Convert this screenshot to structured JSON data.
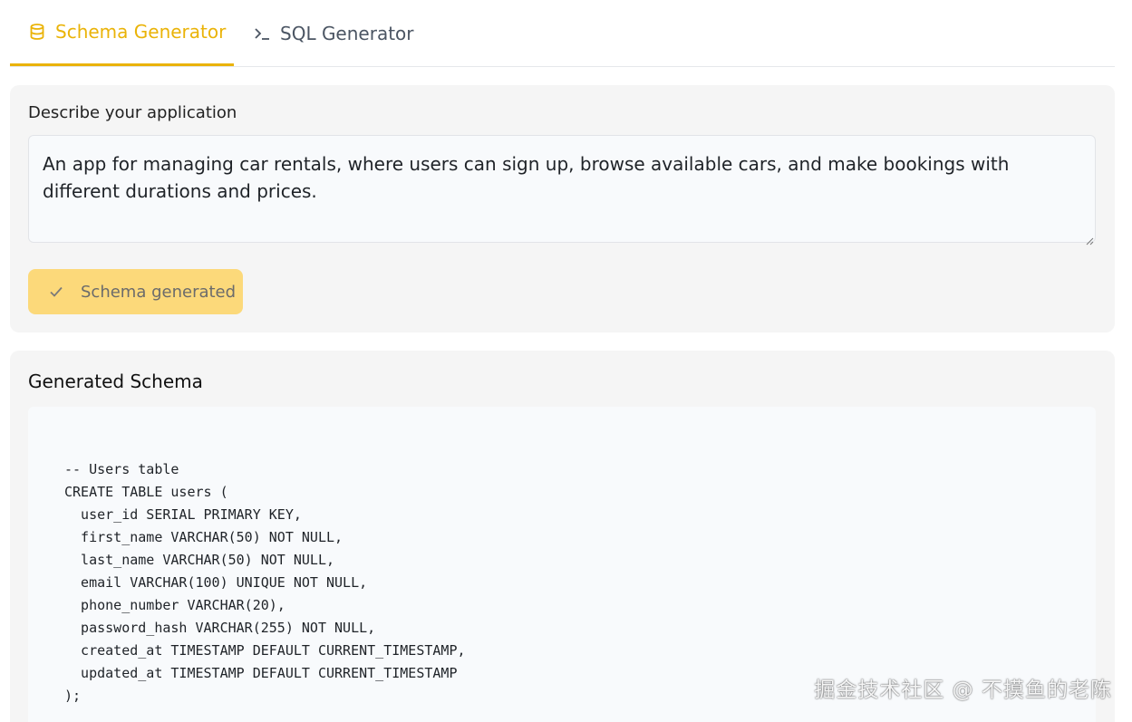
{
  "tabs": {
    "schema_label": "Schema Generator",
    "sql_label": "SQL Generator"
  },
  "input_panel": {
    "label": "Describe your application",
    "description_value": "An app for managing car rentals, where users can sign up, browse available cars, and make bookings with different durations and prices.",
    "button_label": "Schema generated"
  },
  "output_panel": {
    "title": "Generated Schema",
    "code_lines": [
      "-- Users table",
      "CREATE TABLE users (",
      "  user_id SERIAL PRIMARY KEY,",
      "  first_name VARCHAR(50) NOT NULL,",
      "  last_name VARCHAR(50) NOT NULL,",
      "  email VARCHAR(100) UNIQUE NOT NULL,",
      "  phone_number VARCHAR(20),",
      "  password_hash VARCHAR(255) NOT NULL,",
      "  created_at TIMESTAMP DEFAULT CURRENT_TIMESTAMP,",
      "  updated_at TIMESTAMP DEFAULT CURRENT_TIMESTAMP",
      ");"
    ]
  },
  "watermark": "掘金技术社区 @ 不摸鱼的老陈",
  "icons": {
    "schema_tab": "database-icon",
    "sql_tab": "terminal-icon",
    "button": "check-icon"
  },
  "colors": {
    "accent": "#eab308",
    "button_bg": "#fcd97a",
    "panel_bg": "#f5f5f5"
  }
}
